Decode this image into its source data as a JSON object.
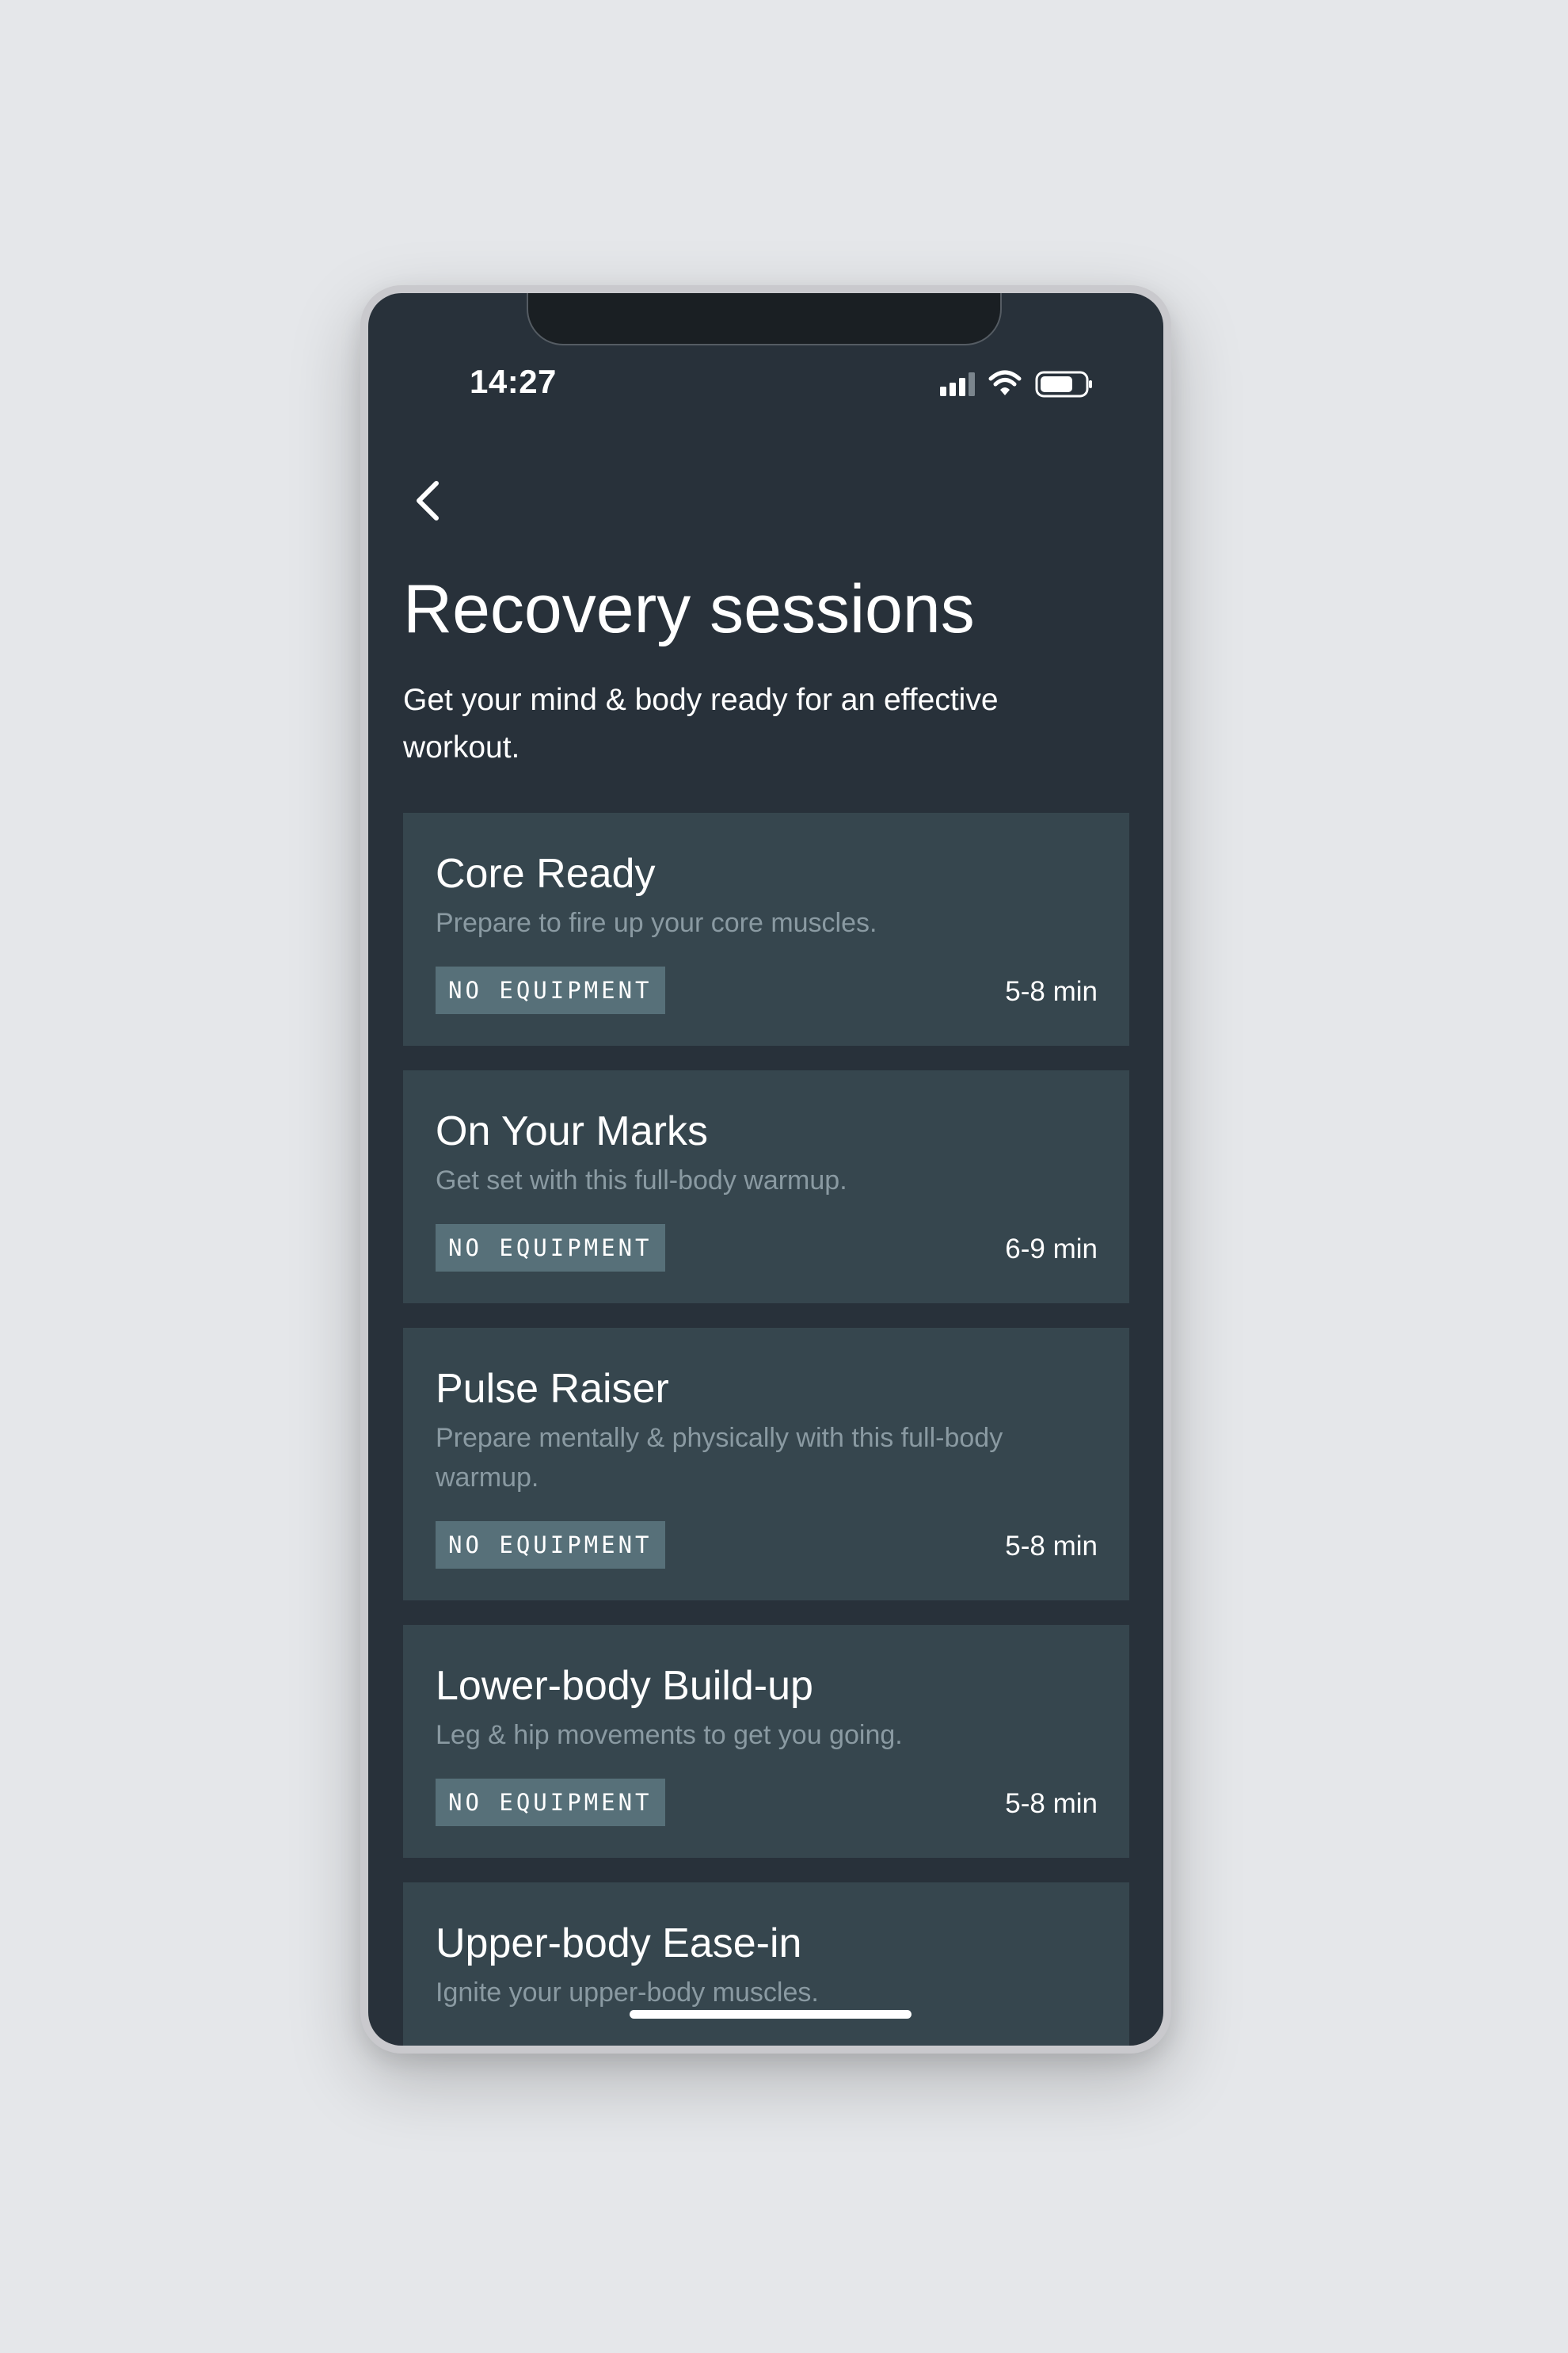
{
  "status_bar": {
    "time": "14:27",
    "icons": [
      "signal-icon",
      "wifi-icon",
      "battery-icon"
    ]
  },
  "header": {
    "back_icon": "chevron-left-icon",
    "title": "Recovery sessions",
    "subtitle": "Get your mind & body ready for an effective workout."
  },
  "sessions": [
    {
      "title": "Core Ready",
      "description": "Prepare to fire up your core muscles.",
      "tag": "NO EQUIPMENT",
      "duration": "5-8 min"
    },
    {
      "title": "On Your Marks",
      "description": "Get set with this full-body warmup.",
      "tag": "NO EQUIPMENT",
      "duration": "6-9 min"
    },
    {
      "title": "Pulse Raiser",
      "description": "Prepare mentally & physically with this full-body warmup.",
      "tag": "NO EQUIPMENT",
      "duration": "5-8 min"
    },
    {
      "title": "Lower-body Build-up",
      "description": "Leg & hip movements to get you going.",
      "tag": "NO EQUIPMENT",
      "duration": "5-8 min"
    },
    {
      "title": "Upper-body Ease-in",
      "description": "Ignite your upper-body muscles."
    }
  ],
  "colors": {
    "page_background": "#e5e7ea",
    "screen_background": "#28313a",
    "card_background": "#36464e",
    "tag_background": "#577079",
    "description_text": "#8a9aa2"
  }
}
